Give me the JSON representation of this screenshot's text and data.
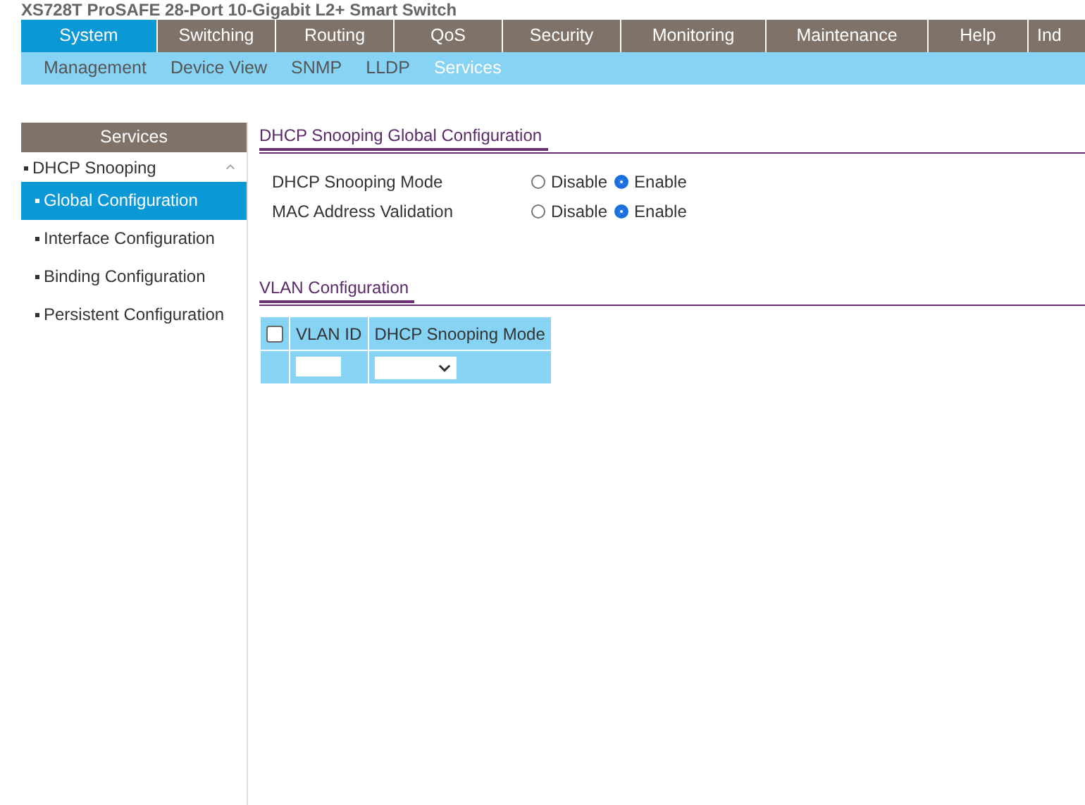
{
  "header": {
    "title": "XS728T ProSAFE 28-Port 10-Gigabit L2+ Smart Switch"
  },
  "main_tabs": [
    {
      "label": "System",
      "selected": true
    },
    {
      "label": "Switching",
      "selected": false
    },
    {
      "label": "Routing",
      "selected": false
    },
    {
      "label": "QoS",
      "selected": false
    },
    {
      "label": "Security",
      "selected": false
    },
    {
      "label": "Monitoring",
      "selected": false
    },
    {
      "label": "Maintenance",
      "selected": false
    },
    {
      "label": "Help",
      "selected": false
    },
    {
      "label": "Ind",
      "selected": false
    }
  ],
  "sub_tabs": [
    {
      "label": "Management",
      "selected": false
    },
    {
      "label": "Device View",
      "selected": false
    },
    {
      "label": "SNMP",
      "selected": false
    },
    {
      "label": "LLDP",
      "selected": false
    },
    {
      "label": "Services",
      "selected": true
    }
  ],
  "sidebar": {
    "title": "Services",
    "groups": [
      {
        "label": "DHCP Snooping",
        "expanded": true,
        "children": [
          {
            "label": "Global Configuration",
            "selected": true
          },
          {
            "label": "Interface Configuration",
            "selected": false
          },
          {
            "label": "Binding Configuration",
            "selected": false
          },
          {
            "label": "Persistent Configuration",
            "selected": false
          }
        ]
      }
    ]
  },
  "global_section": {
    "title": "DHCP Snooping Global Configuration",
    "fields": [
      {
        "label": "DHCP Snooping Mode",
        "options": [
          {
            "label": "Disable",
            "selected": false
          },
          {
            "label": "Enable",
            "selected": true
          }
        ]
      },
      {
        "label": "MAC Address Validation",
        "options": [
          {
            "label": "Disable",
            "selected": false
          },
          {
            "label": "Enable",
            "selected": true
          }
        ]
      }
    ]
  },
  "vlan_section": {
    "title": "VLAN Configuration",
    "columns": [
      "VLAN ID",
      "DHCP Snooping Mode"
    ],
    "select_all_checked": false
  }
}
